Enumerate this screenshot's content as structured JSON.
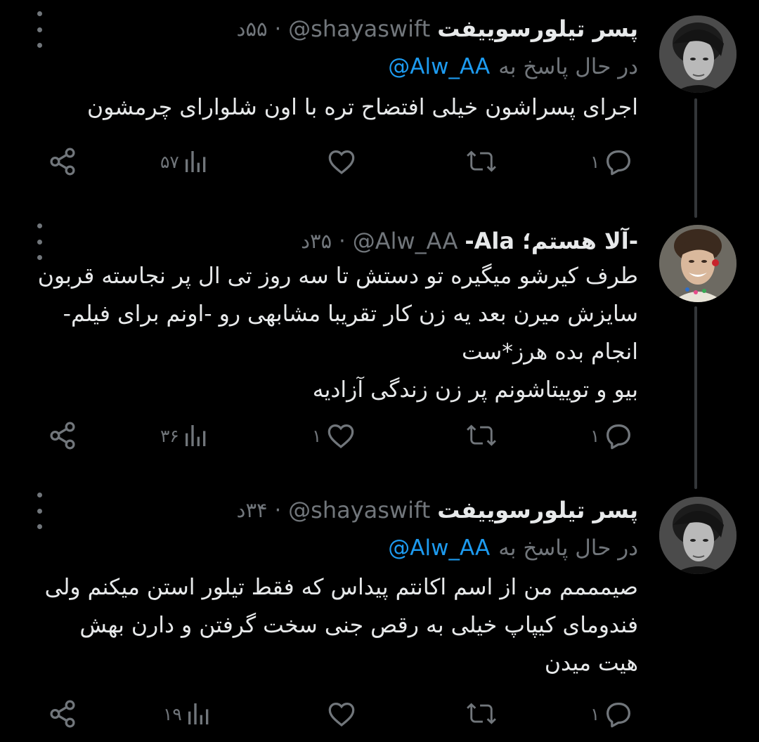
{
  "tweets": [
    {
      "name": "پسر تیلورسوییفت",
      "handle": "@shayaswift",
      "dot": "·",
      "time": "۵۵د",
      "replying_label": "در حال پاسخ به",
      "replying_to": "@Alw_AA",
      "text": "اجرای پسراشون خیلی افتضاح تره با اون شلوارای چرمشون",
      "replies": "۱",
      "retweets": "",
      "likes": "",
      "views": "۵۷"
    },
    {
      "name": "-آلا هستم؛ Ala-",
      "handle": "@Alw_AA",
      "dot": "·",
      "time": "۳۵د",
      "text": "طرف کیرشو میگیره تو دستش تا سه روز تی ال پر نجاسته قربون سایزش میرن بعد یه زن کار تقریبا مشابهی رو -اونم برای فیلم- انجام بده هرز*ست\nبیو و توییتاشونم پر زن زندگی آزادیه",
      "replies": "۱",
      "retweets": "",
      "likes": "۱",
      "views": "۳۶"
    },
    {
      "name": "پسر تیلورسوییفت",
      "handle": "@shayaswift",
      "dot": "·",
      "time": "۳۴د",
      "replying_label": "در حال پاسخ به",
      "replying_to": "@Alw_AA",
      "text": "صیمممم من از اسم اکانتم پیداس که فقط تیلور استن میکنم ولی فندومای کیپاپ خیلی به رقص جنی سخت گرفتن و دارن بهش هیت میدن",
      "replies": "۱",
      "retweets": "",
      "likes": "",
      "views": "۱۹"
    }
  ],
  "icons": {
    "reply": "reply-icon",
    "retweet": "retweet-icon",
    "like": "heart-icon",
    "views": "views-icon",
    "share": "share-icon",
    "more": "more-icon"
  },
  "colors": {
    "background": "#000000",
    "text": "#e7e9ea",
    "muted": "#71767b",
    "link": "#1d9bf0"
  }
}
